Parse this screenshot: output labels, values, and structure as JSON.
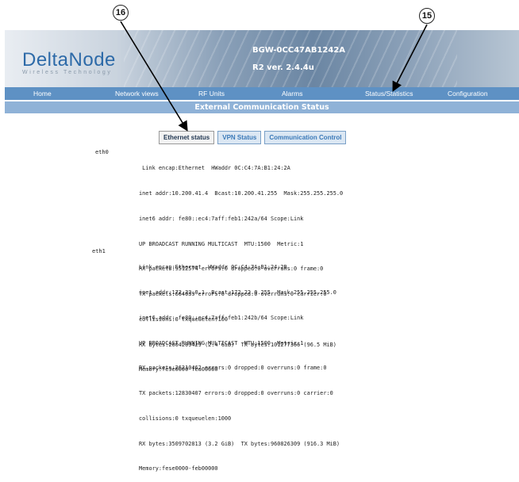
{
  "callouts": [
    "16",
    "15"
  ],
  "header": {
    "logo": "DeltaNode",
    "logo_tagline": "Wireless Technology",
    "device_name": "BGW-0CC47AB1242A",
    "version": "R2 ver. 2.4.4u"
  },
  "nav": {
    "items": [
      "Home",
      "Network views",
      "RF Units",
      "Alarms",
      "Status/Statistics",
      "Configuration"
    ]
  },
  "page_title": "External Communication Status",
  "tabs": [
    "Ethernet status",
    "VPN Status",
    "Communication Control"
  ],
  "interfaces": [
    {
      "name": "eth0",
      "lines": [
        " Link encap:Ethernet  HWaddr 0C:C4:7A:B1:24:2A",
        "inet addr:10.200.41.4  Bcast:10.200.41.255  Mask:255.255.255.0",
        "inet6 addr: fe80::ec4:7aff:feb1:242a/64 Scope:Link",
        "UP BROADCAST RUNNING MULTICAST  MTU:1500  Metric:1",
        "RX packets:9512574 errors:0 dropped:0 overruns:0 frame:0",
        "TX packets:664039 errors:0 dropped:0 overruns:0 carrier:0",
        "collisions:0 txqueuelen:100",
        "RX bytes:2604209429 (2.4 GiB)  TX bytes:101277366 (96.5 MiB)",
        "Memory:fe9e0000-fea00000"
      ]
    },
    {
      "name": "eth1",
      "lines": [
        "Link encap:Ethernet  HWaddr 0C:C4:7A:B1:24:2B",
        "inet addr:172.22.0.1  Bcast:172.22.0.255  Mask:255.255.255.0",
        "inet6 addr: fe80::ec4:7aff:feb1:242b/64 Scope:Link",
        "UP BROADCAST RUNNING MULTICAST  MTU:1500  Metric:1",
        "RX packets:26210462 errors:0 dropped:0 overruns:0 frame:0",
        "TX packets:12830407 errors:0 dropped:0 overruns:0 carrier:0",
        "collisions:0 txqueuelen:1000",
        "RX bytes:3509702813 (3.2 GiB)  TX bytes:960826309 (916.3 MiB)",
        "Memory:fese0000-feb00000"
      ]
    }
  ]
}
